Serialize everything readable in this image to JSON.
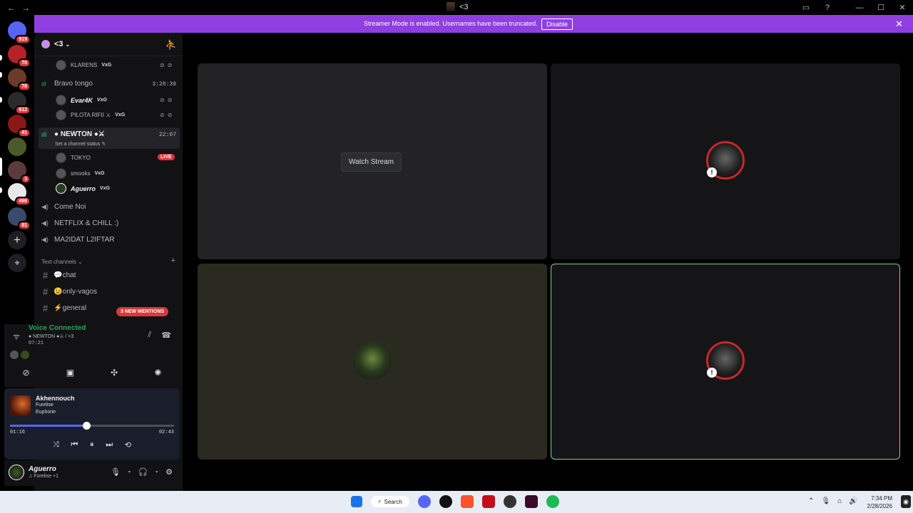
{
  "window": {
    "title": "<3",
    "back": "←",
    "forward": "→"
  },
  "banner": {
    "message": "Streamer Mode is enabled. Usernames have been truncated.",
    "button": "Disable",
    "close": "✕"
  },
  "server_rail": {
    "items": [
      {
        "name": "discord-home",
        "badge": "919",
        "color": "#5865f2"
      },
      {
        "name": "server-1",
        "badge": "70",
        "color": "#b4232a"
      },
      {
        "name": "server-2",
        "badge": "78",
        "color": "#6a3b2a"
      },
      {
        "name": "server-3",
        "badge": "812",
        "color": "#2a2a2a"
      },
      {
        "name": "server-4",
        "badge": "41",
        "color": "#8a1818"
      },
      {
        "name": "server-5",
        "badge": "",
        "color": "#4a5a2a"
      },
      {
        "name": "server-6",
        "badge": "3",
        "color": "#5a3a3a"
      },
      {
        "name": "server-7",
        "badge": "498",
        "color": "#e8e8e8"
      },
      {
        "name": "server-8",
        "badge": "81",
        "color": "#3a4a6a"
      }
    ],
    "add": "+",
    "explore": "⌖"
  },
  "sidebar": {
    "server_name": "<3",
    "voice_channels": [
      {
        "name": "",
        "members": [
          {
            "name": "KLARENS",
            "tag": "VxG",
            "status_icons": "⊘⊘"
          }
        ]
      },
      {
        "name": "Bravo tongo",
        "time": "3:28:39",
        "members": [
          {
            "name": "Evar4K",
            "tag": "VxG",
            "status_icons": "⊘⊘"
          },
          {
            "name": "PILOTA RIFII ⚔",
            "tag": "VxG",
            "status_icons": "⊘⊘"
          }
        ]
      },
      {
        "name": "● NEWTON ●⚔",
        "time": "22:07",
        "status": "Set a channel status ✎",
        "members": [
          {
            "name": "TOKYO",
            "live": "LIVE"
          },
          {
            "name": "smooks",
            "tag": "VxG"
          },
          {
            "name": "Aguerro",
            "tag": "VxG"
          }
        ]
      }
    ],
    "other_channels": [
      "Come Noi",
      "NETFLIX & CHILL :)",
      "MA2IDAT L2IFTAR"
    ],
    "text_header": "Text channels ⌄",
    "text_channels": [
      "💬chat",
      "😉only-vagos",
      "⚡general"
    ],
    "mentions": "3 NEW MENTIONS"
  },
  "voice": {
    "label": "Voice Connected",
    "channel": "● NEWTON ●⚔ / <3",
    "time": "07:21"
  },
  "music": {
    "title": "Akhennouch",
    "artist": "Furelise",
    "album": "Euphorie",
    "elapsed": "01:16",
    "duration": "02:43",
    "progress": 0.466
  },
  "user": {
    "name": "Aguerro",
    "status": "♫ Furelise +1"
  },
  "stage": {
    "watch_stream": "Watch Stream"
  },
  "taskbar": {
    "search": "Search",
    "time": "7:34 PM",
    "date": "2/28/2026"
  }
}
